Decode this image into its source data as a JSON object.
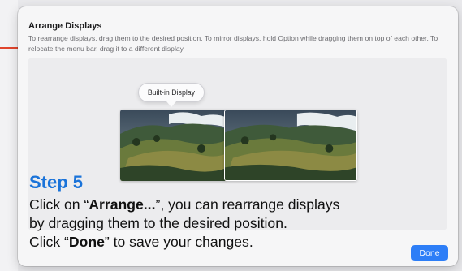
{
  "sheet": {
    "title": "Arrange Displays",
    "description": "To rearrange displays, drag them to the desired position. To mirror displays, hold Option while dragging them on top of each other. To relocate the menu bar, drag it to a different display."
  },
  "tooltip": {
    "label": "Built-in Display"
  },
  "displays": [
    {
      "name": "built-in-display-thumbnail",
      "wallpaper": "sonoma-hills"
    },
    {
      "name": "external-display-thumbnail",
      "wallpaper": "sonoma-hills"
    }
  ],
  "step": {
    "heading": "Step 5",
    "line1_pre": "Click on “",
    "line1_bold": "Arrange...",
    "line1_post": "”, you can rearrange displays",
    "line2": "by dragging them to the desired position.",
    "line3_pre": "Click “",
    "line3_bold": "Done",
    "line3_post": "” to save your changes."
  },
  "buttons": {
    "done": "Done"
  },
  "colors": {
    "accent": "#2d7ef7",
    "step_heading": "#1a73d9"
  }
}
